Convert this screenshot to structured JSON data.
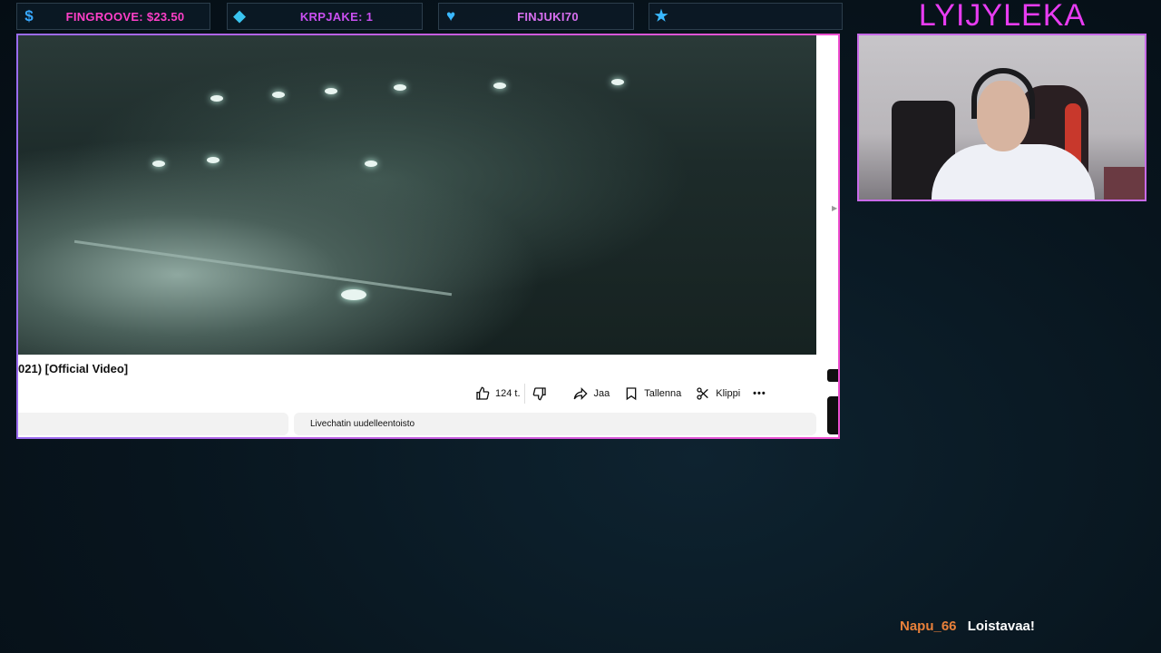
{
  "alerts": [
    {
      "icon": "dollar-icon",
      "icon_glyph": "$",
      "text": "FINGROOVE: $23.50"
    },
    {
      "icon": "diamond-icon",
      "icon_glyph": "◆",
      "text": "KRPJAKE: 1"
    },
    {
      "icon": "heart-icon",
      "icon_glyph": "♥",
      "text": "FINJUKI70"
    },
    {
      "icon": "star-icon",
      "icon_glyph": "★",
      "text": ""
    }
  ],
  "channel": {
    "name": "LYIJYLEKA"
  },
  "youtube": {
    "video_title": "021) [Official Video]",
    "like_count": "124 t.",
    "share_label": "Jaa",
    "save_label": "Tallenna",
    "clip_label": "Klippi",
    "more_label": "•••",
    "chat_replay_label": "Livechatin uudelleentoisto"
  },
  "chat": {
    "user": "Napu_66",
    "message": "Loistavaa!"
  },
  "colors": {
    "accent_magenta": "#e83cf2",
    "chat_user": "#e8803a",
    "alert_blue": "#38a8ff"
  }
}
